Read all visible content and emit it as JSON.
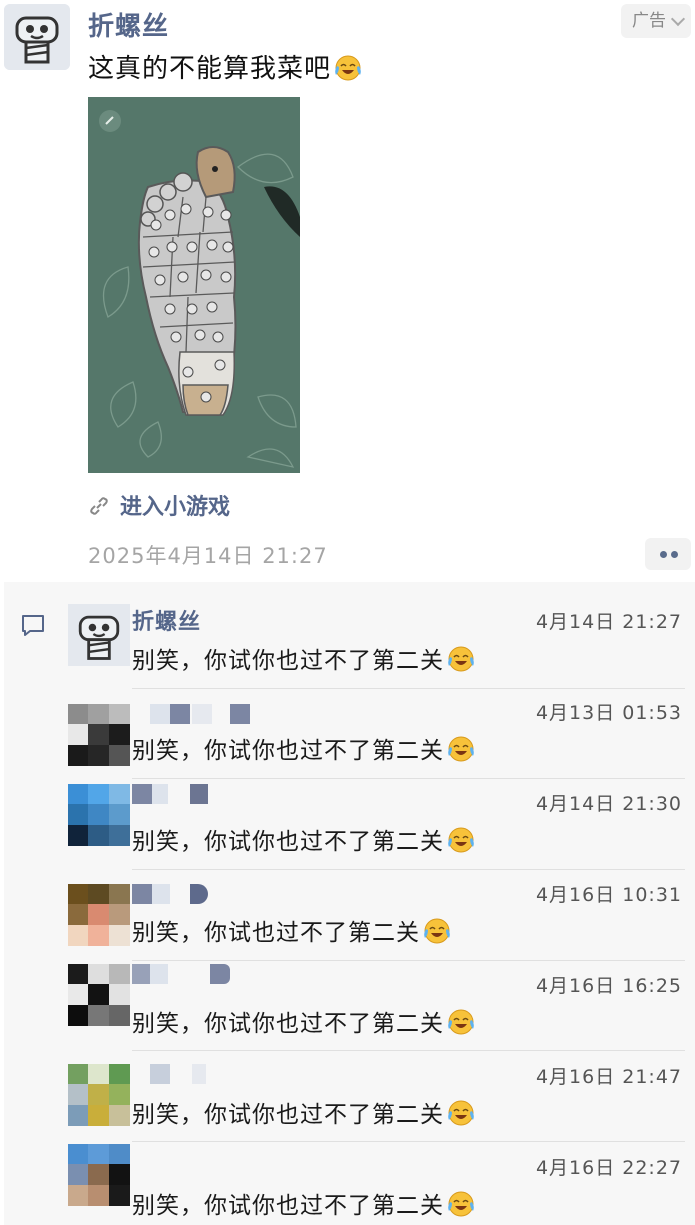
{
  "post": {
    "author": "折螺丝",
    "ad_label": "广告",
    "text": "这真的不能算我菜吧",
    "emoji": "crying-laughing-emoji",
    "mini_game_link": "进入小游戏",
    "timestamp": "2025年4月14日 21:27"
  },
  "comments": [
    {
      "author": "折螺丝",
      "text": "别笑，你试你也过不了第二关",
      "time": "4月14日 21:27"
    },
    {
      "author": "",
      "text": "别笑，你试你也过不了第二关",
      "time": "4月13日 01:53"
    },
    {
      "author": "",
      "text": "别笑，你试你也过不了第二关",
      "time": "4月14日 21:30"
    },
    {
      "author": "",
      "text": "别笑，你试也过不了第二关",
      "time": "4月16日 10:31"
    },
    {
      "author": "",
      "text": "别笑，你试你也过不了第二关",
      "time": "4月16日 16:25"
    },
    {
      "author": "",
      "text": "别笑，你试你也过不了第二关",
      "time": "4月16日 21:47"
    },
    {
      "author": "",
      "text": "别笑，你试你也过不了第二关",
      "time": "4月16日 22:27"
    }
  ],
  "colors": {
    "name_link": "#55668a",
    "timestamp": "#a5a5a5",
    "comments_bg": "#f7f7f7",
    "game_bg": "#55776a"
  }
}
